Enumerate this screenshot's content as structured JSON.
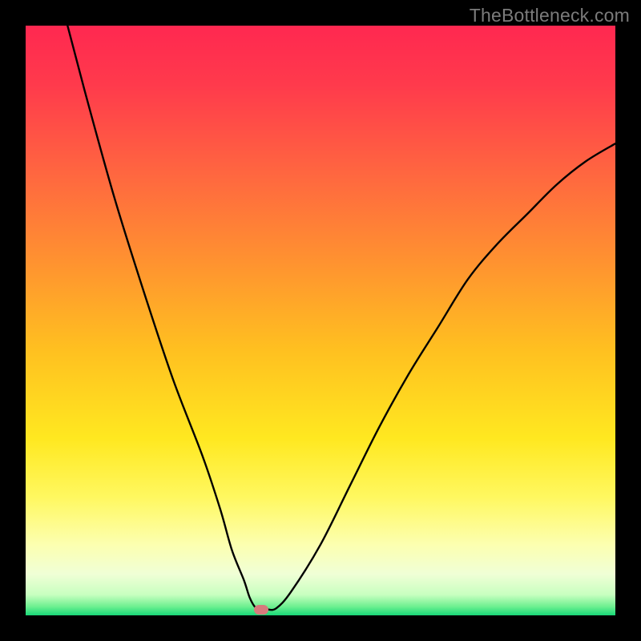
{
  "watermark": "TheBottleneck.com",
  "chart_data": {
    "type": "line",
    "title": "",
    "xlabel": "",
    "ylabel": "",
    "xlim": [
      0,
      100
    ],
    "ylim": [
      0,
      100
    ],
    "grid": false,
    "axes": false,
    "background_gradient": {
      "stops": [
        {
          "pos": 0.0,
          "color": "#ff2850"
        },
        {
          "pos": 0.1,
          "color": "#ff3a4c"
        },
        {
          "pos": 0.25,
          "color": "#ff6640"
        },
        {
          "pos": 0.4,
          "color": "#ff9230"
        },
        {
          "pos": 0.55,
          "color": "#ffc020"
        },
        {
          "pos": 0.7,
          "color": "#ffe820"
        },
        {
          "pos": 0.8,
          "color": "#fff860"
        },
        {
          "pos": 0.88,
          "color": "#fcffb0"
        },
        {
          "pos": 0.93,
          "color": "#f0ffd6"
        },
        {
          "pos": 0.965,
          "color": "#c8ffc0"
        },
        {
          "pos": 0.985,
          "color": "#6ef090"
        },
        {
          "pos": 1.0,
          "color": "#18d878"
        }
      ]
    },
    "series": [
      {
        "name": "bottleneck-curve",
        "color": "#000000",
        "x": [
          0,
          5,
          10,
          15,
          20,
          25,
          30,
          33,
          35,
          37,
          38,
          39,
          40,
          41,
          42.5,
          45,
          50,
          55,
          60,
          65,
          70,
          75,
          80,
          85,
          90,
          95,
          100
        ],
        "y": [
          128,
          108,
          89,
          71,
          55,
          40,
          27,
          18,
          11,
          6,
          3,
          1.3,
          1,
          1,
          1.2,
          4,
          12,
          22,
          32,
          41,
          49,
          57,
          63,
          68,
          73,
          77,
          80
        ]
      }
    ],
    "marker": {
      "name": "optimal-point",
      "x": 40,
      "y": 1,
      "color": "#d77a7c"
    }
  }
}
